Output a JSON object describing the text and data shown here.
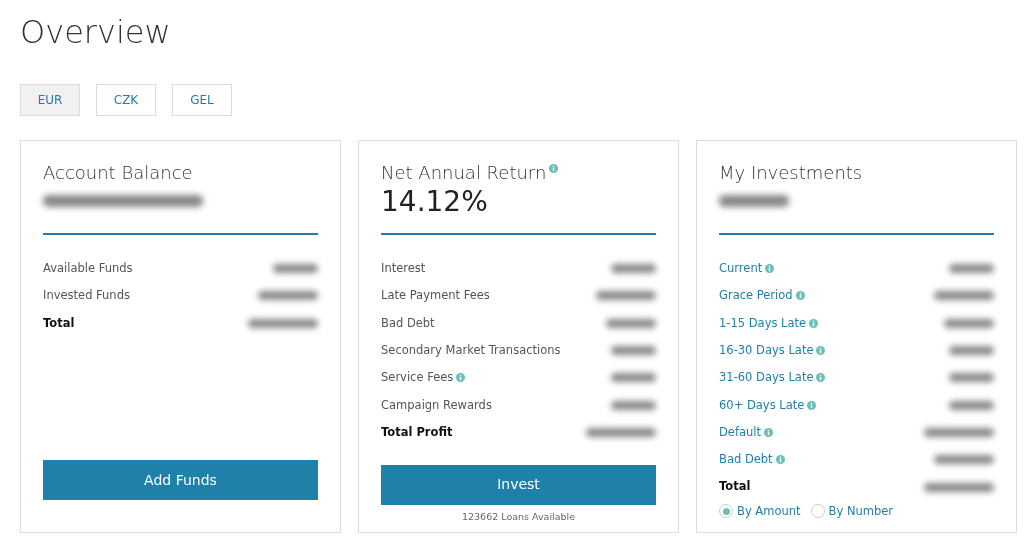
{
  "page_title": "Overview",
  "currencies": [
    {
      "label": "EUR",
      "selected": true
    },
    {
      "label": "CZK",
      "selected": false
    },
    {
      "label": "GEL",
      "selected": false
    }
  ],
  "cards": [
    {
      "title": "Account Balance",
      "info": false,
      "rows": [
        {
          "label": "Available Funds",
          "kind": "plain",
          "info": false
        },
        {
          "label": "Invested Funds",
          "kind": "plain",
          "info": false
        },
        {
          "label": "Total",
          "kind": "total",
          "info": false
        }
      ],
      "button": "Add Funds"
    },
    {
      "title": "Net Annual Return",
      "info": true,
      "headline": "14.12%",
      "rows": [
        {
          "label": "Interest",
          "kind": "plain",
          "info": false
        },
        {
          "label": "Late Payment Fees",
          "kind": "plain",
          "info": false
        },
        {
          "label": "Bad Debt",
          "kind": "plain",
          "info": false
        },
        {
          "label": "Secondary Market Transactions",
          "kind": "plain",
          "info": false
        },
        {
          "label": "Service Fees",
          "kind": "plain",
          "info": true
        },
        {
          "label": "Campaign Rewards",
          "kind": "plain",
          "info": false
        },
        {
          "label": "Total Profit",
          "kind": "total",
          "info": false
        }
      ],
      "button": "Invest",
      "note": "123662 Loans Available"
    },
    {
      "title": "My Investments",
      "info": false,
      "rows": [
        {
          "label": "Current",
          "kind": "link",
          "info": true
        },
        {
          "label": "Grace Period",
          "kind": "link",
          "info": true
        },
        {
          "label": "1-15 Days Late",
          "kind": "link",
          "info": true
        },
        {
          "label": "16-30 Days Late",
          "kind": "link",
          "info": true
        },
        {
          "label": "31-60 Days Late",
          "kind": "link",
          "info": true
        },
        {
          "label": "60+ Days Late",
          "kind": "link",
          "info": true
        },
        {
          "label": "Default",
          "kind": "link",
          "info": true
        },
        {
          "label": "Bad Debt",
          "kind": "link",
          "info": true
        },
        {
          "label": "Total",
          "kind": "total",
          "info": false
        }
      ],
      "options": [
        {
          "label": "By Amount",
          "selected": true
        },
        {
          "label": "By Number",
          "selected": false
        }
      ]
    }
  ]
}
